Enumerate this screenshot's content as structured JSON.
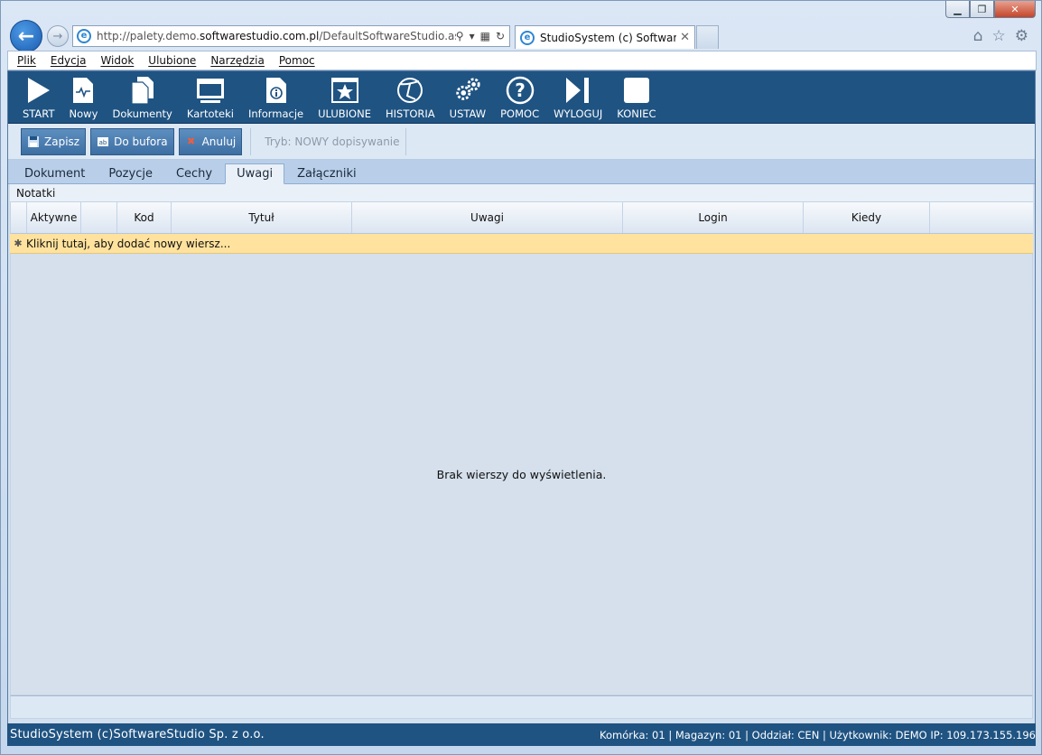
{
  "window": {
    "minimize": "▭",
    "maximize": "▢",
    "close": "✕"
  },
  "browser": {
    "address_prefix": "http://palety.demo.",
    "address_domain": "softwarestudio.com.pl",
    "address_suffix": "/DefaultSoftwareStudio.aspx?rol",
    "tab_title": "StudioSystem (c) SoftwareS...",
    "tab_close": "✕"
  },
  "menu": [
    "Plik",
    "Edycja",
    "Widok",
    "Ulubione",
    "Narzędzia",
    "Pomoc"
  ],
  "toolbar": [
    {
      "label": "START",
      "icon": "play-icon"
    },
    {
      "label": "Nowy",
      "icon": "new-document-icon"
    },
    {
      "label": "Dokumenty",
      "icon": "documents-icon"
    },
    {
      "label": "Kartoteki",
      "icon": "monitor-icon"
    },
    {
      "label": "Informacje",
      "icon": "info-document-icon"
    },
    {
      "label": "ULUBIONE",
      "icon": "star-icon"
    },
    {
      "label": "HISTORIA",
      "icon": "history-icon"
    },
    {
      "label": "USTAW",
      "icon": "gears-icon"
    },
    {
      "label": "POMOC",
      "icon": "help-icon"
    },
    {
      "label": "WYLOGUJ",
      "icon": "logout-icon"
    },
    {
      "label": "KONIEC",
      "icon": "stop-icon"
    }
  ],
  "actions": {
    "save": "Zapisz",
    "buffer": "Do bufora",
    "cancel": "Anuluj",
    "mode": "Tryb: NOWY dopisywanie"
  },
  "tabs": [
    "Dokument",
    "Pozycje",
    "Cechy",
    "Uwagi",
    "Załączniki"
  ],
  "active_tab": "Uwagi",
  "section": {
    "title": "Notatki"
  },
  "grid": {
    "columns": [
      "Aktywne",
      "",
      "Kod",
      "Tytuł",
      "Uwagi",
      "Login",
      "Kiedy",
      ""
    ],
    "new_row_marker": "✱",
    "new_row_text": "Kliknij tutaj, aby dodać nowy wiersz...",
    "empty_text": "Brak wierszy do wyświetlenia."
  },
  "status": {
    "left": "StudioSystem (c)SoftwareStudio Sp. z o.o.",
    "right": "Komórka: 01 | Magazyn: 01 | Oddział: CEN | Użytkownik: DEMO IP: 109.173.155.196"
  },
  "colors": {
    "toolbar_bg": "#1f5382",
    "new_row_bg": "#ffe29d",
    "button_bg": "#4a7bb0"
  }
}
